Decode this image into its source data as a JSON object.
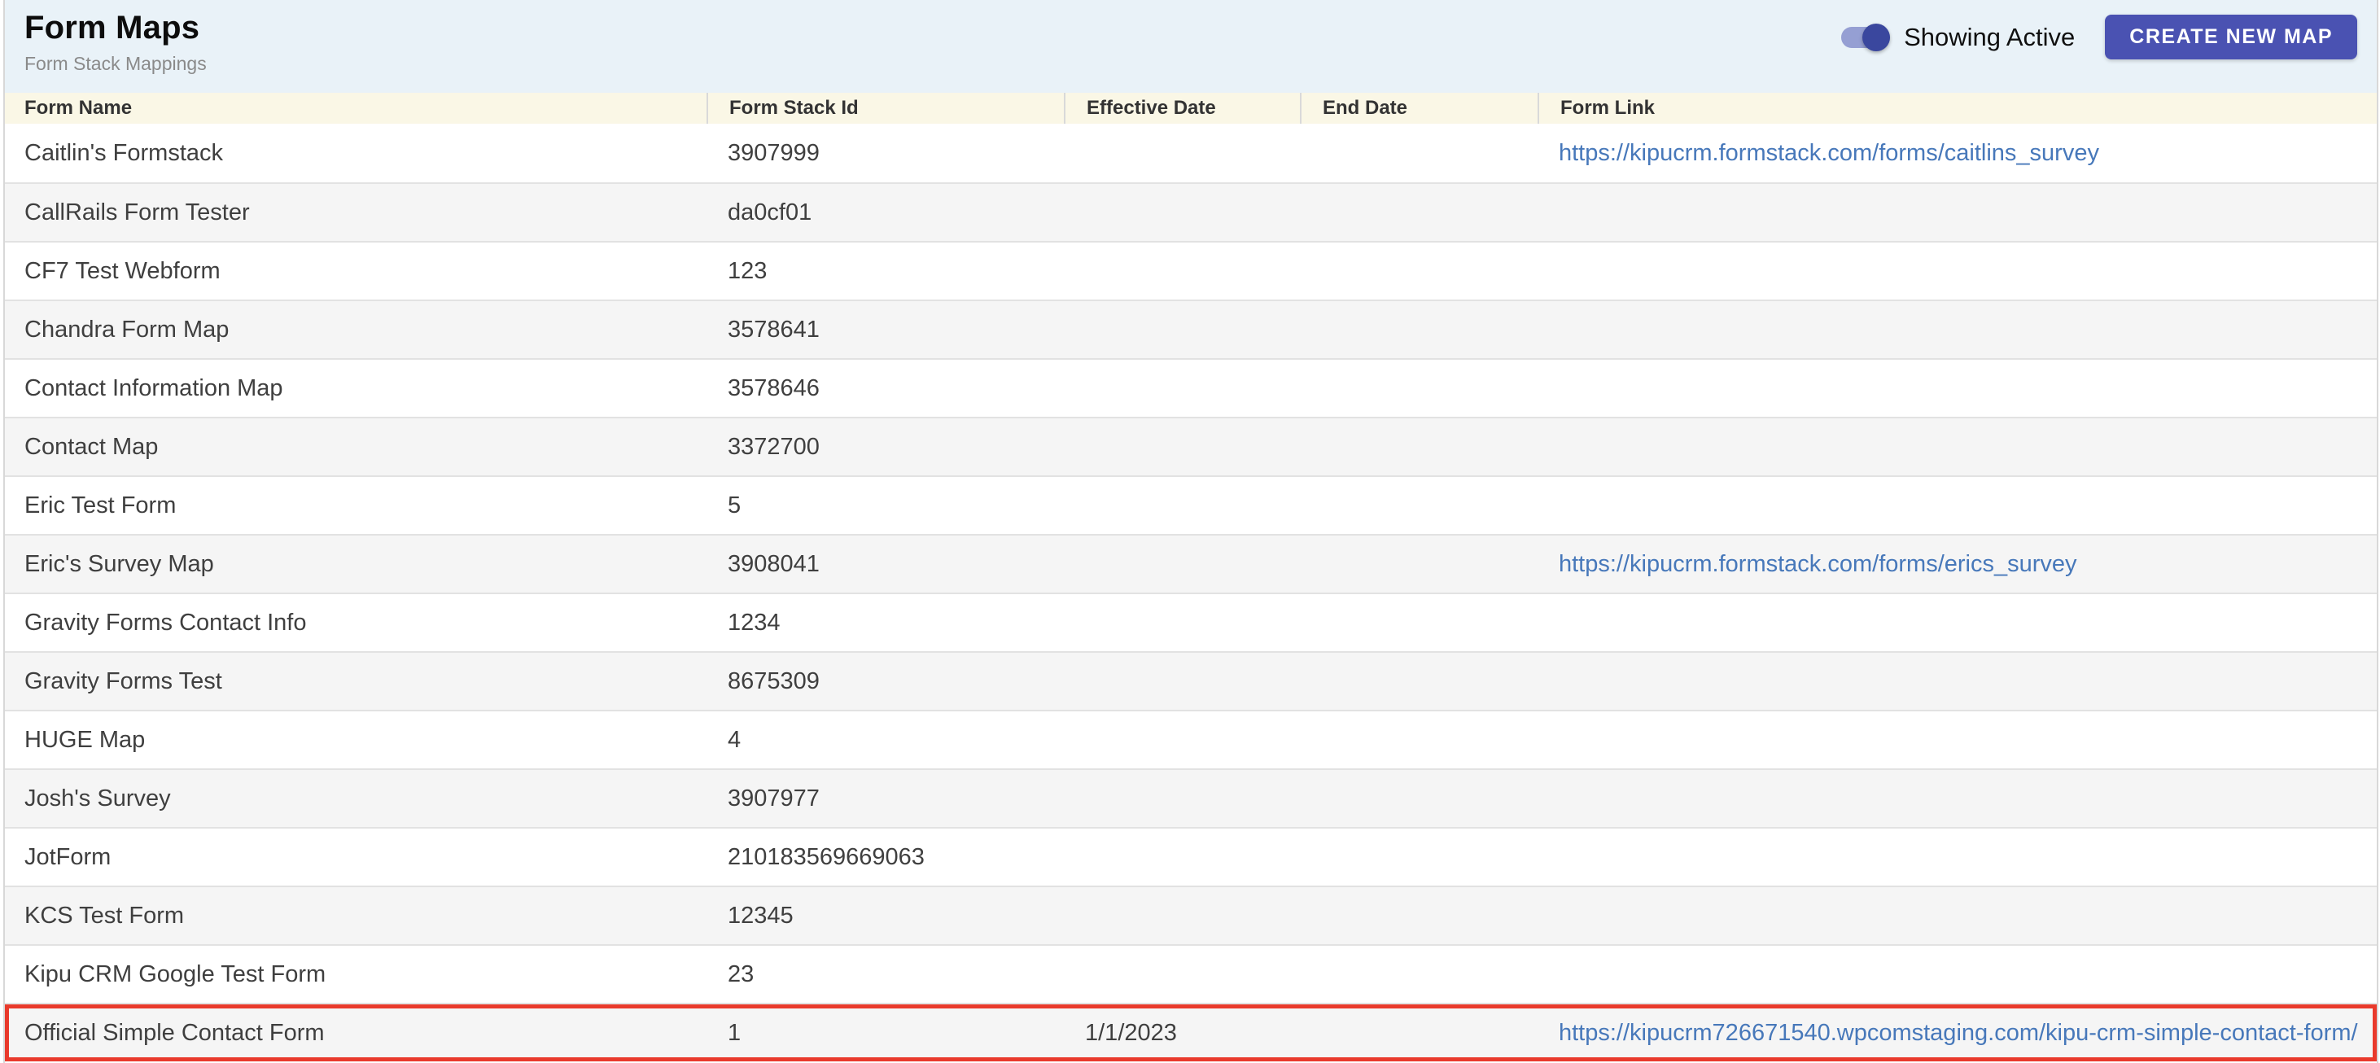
{
  "header": {
    "title": "Form Maps",
    "subtitle": "Form Stack Mappings",
    "toggle_label": "Showing Active",
    "toggle_state": "on",
    "create_button_label": "CREATE NEW MAP"
  },
  "colors": {
    "topbar_bg": "#e9f2f8",
    "table_header_bg": "#faf7e6",
    "alt_row_bg": "#f5f5f5",
    "button_bg": "#4a52b2",
    "toggle_thumb": "#3a479e",
    "toggle_track": "#959fd3",
    "link": "#4778ba",
    "highlight_border": "#e93a2c"
  },
  "table": {
    "columns": [
      "Form Name",
      "Form Stack Id",
      "Effective Date",
      "End Date",
      "Form Link"
    ],
    "rows": [
      {
        "name": "Caitlin's Formstack",
        "stack_id": "3907999",
        "effective_date": "",
        "end_date": "",
        "link": "https://kipucrm.formstack.com/forms/caitlins_survey",
        "highlighted": false
      },
      {
        "name": "CallRails Form Tester",
        "stack_id": "da0cf01",
        "effective_date": "",
        "end_date": "",
        "link": "",
        "highlighted": false
      },
      {
        "name": "CF7 Test Webform",
        "stack_id": "123",
        "effective_date": "",
        "end_date": "",
        "link": "",
        "highlighted": false
      },
      {
        "name": "Chandra Form Map",
        "stack_id": "3578641",
        "effective_date": "",
        "end_date": "",
        "link": "",
        "highlighted": false
      },
      {
        "name": "Contact Information Map",
        "stack_id": "3578646",
        "effective_date": "",
        "end_date": "",
        "link": "",
        "highlighted": false
      },
      {
        "name": "Contact Map",
        "stack_id": "3372700",
        "effective_date": "",
        "end_date": "",
        "link": "",
        "highlighted": false
      },
      {
        "name": "Eric Test Form",
        "stack_id": "5",
        "effective_date": "",
        "end_date": "",
        "link": "",
        "highlighted": false
      },
      {
        "name": "Eric's Survey Map",
        "stack_id": "3908041",
        "effective_date": "",
        "end_date": "",
        "link": "https://kipucrm.formstack.com/forms/erics_survey",
        "highlighted": false
      },
      {
        "name": "Gravity Forms Contact Info",
        "stack_id": "1234",
        "effective_date": "",
        "end_date": "",
        "link": "",
        "highlighted": false
      },
      {
        "name": "Gravity Forms Test",
        "stack_id": "8675309",
        "effective_date": "",
        "end_date": "",
        "link": "",
        "highlighted": false
      },
      {
        "name": "HUGE Map",
        "stack_id": "4",
        "effective_date": "",
        "end_date": "",
        "link": "",
        "highlighted": false
      },
      {
        "name": "Josh's Survey",
        "stack_id": "3907977",
        "effective_date": "",
        "end_date": "",
        "link": "",
        "highlighted": false
      },
      {
        "name": "JotForm",
        "stack_id": "210183569669063",
        "effective_date": "",
        "end_date": "",
        "link": "",
        "highlighted": false
      },
      {
        "name": "KCS Test Form",
        "stack_id": "12345",
        "effective_date": "",
        "end_date": "",
        "link": "",
        "highlighted": false
      },
      {
        "name": "Kipu CRM Google Test Form",
        "stack_id": "23",
        "effective_date": "",
        "end_date": "",
        "link": "",
        "highlighted": false
      },
      {
        "name": "Official Simple Contact Form",
        "stack_id": "1",
        "effective_date": "1/1/2023",
        "end_date": "",
        "link": "https://kipucrm726671540.wpcomstaging.com/kipu-crm-simple-contact-form/",
        "highlighted": true
      }
    ]
  }
}
